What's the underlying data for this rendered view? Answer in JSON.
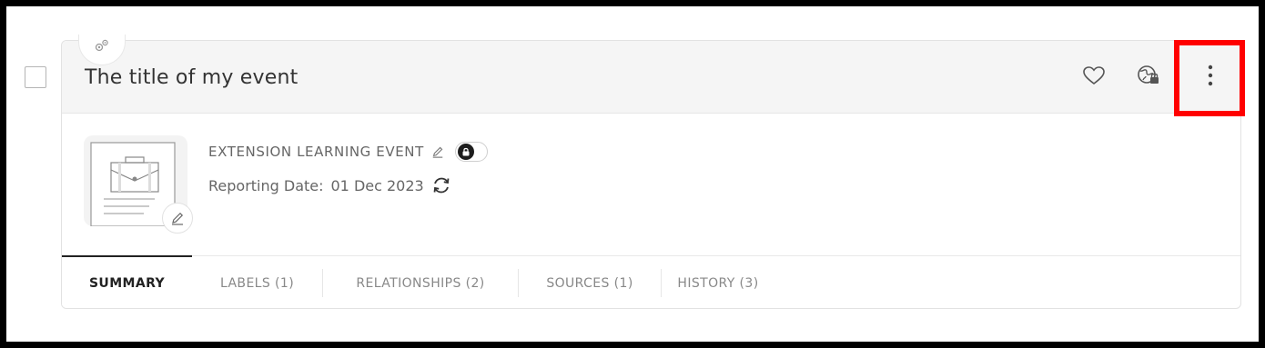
{
  "card": {
    "title": "The title of my event",
    "type_badge_icon": "gears-icon",
    "event_type": "EXTENSION LEARNING EVENT",
    "reporting_date_label": "Reporting Date:",
    "reporting_date_value": "01 Dec 2023"
  },
  "header_actions": {
    "favorite_icon": "heart-icon",
    "globe_icon": "globe-lock-icon",
    "more_icon": "more-vertical-icon"
  },
  "tabs": [
    {
      "label": "SUMMARY",
      "active": true
    },
    {
      "label": "LABELS (1)",
      "active": false
    },
    {
      "label": "RELATIONSHIPS (2)",
      "active": false
    },
    {
      "label": "SOURCES (1)",
      "active": false
    },
    {
      "label": "HISTORY (3)",
      "active": false
    }
  ],
  "colors": {
    "highlight": "#ff0000",
    "header_bg": "#f5f5f5",
    "frame": "#000000"
  }
}
